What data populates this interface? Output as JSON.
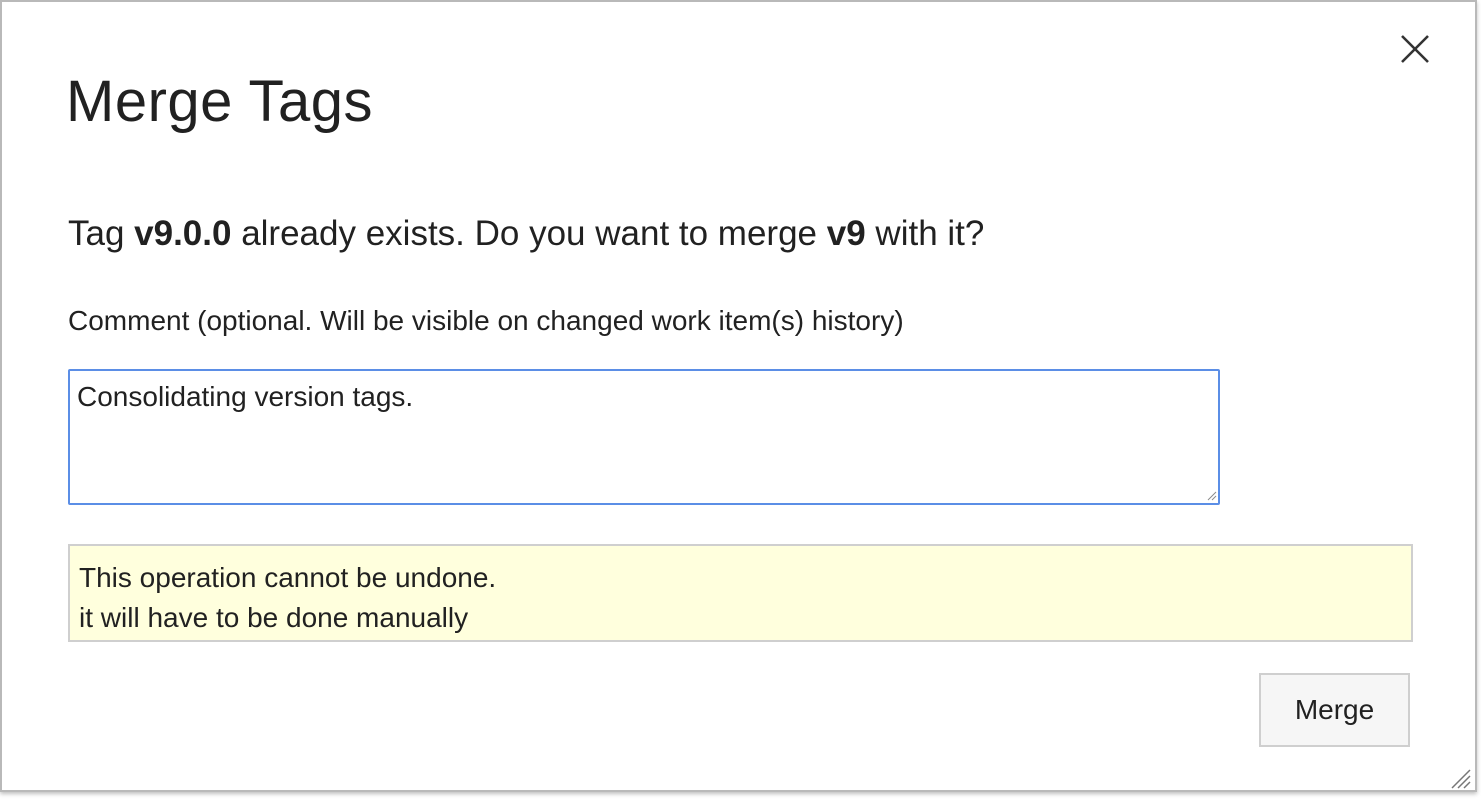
{
  "dialog": {
    "title": "Merge Tags",
    "close_icon": "close-icon",
    "question": {
      "prefix": "Tag ",
      "existing_tag": "v9.0.0",
      "middle": " already exists. Do you want to merge ",
      "source_tag": "v9",
      "suffix": " with it?"
    },
    "comment": {
      "label": "Comment (optional. Will be visible on changed work item(s) history)",
      "value": "Consolidating version tags."
    },
    "warning": {
      "line1": "This operation cannot be undone.",
      "line2": "it will have to be done manually",
      "background": "#ffffdd"
    },
    "merge_button_label": "Merge",
    "accent_color": "#5b8ee6"
  }
}
